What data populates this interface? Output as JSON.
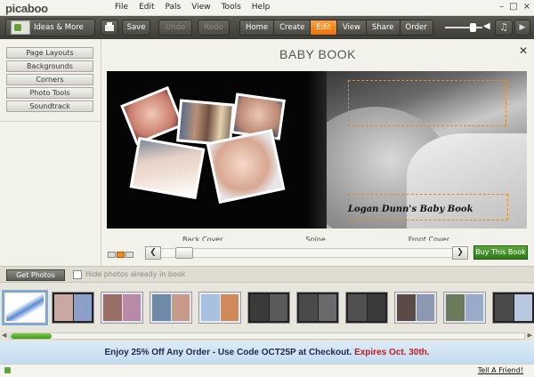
{
  "app": {
    "logo": "picaboo"
  },
  "menu": [
    "File",
    "Edit",
    "Pals",
    "View",
    "Tools",
    "Help"
  ],
  "toolbar": {
    "ideas_label": "Ideas & More",
    "save_label": "Save",
    "undo_label": "Undo",
    "redo_label": "Redo",
    "nav": [
      "Home",
      "Create",
      "Edit",
      "View",
      "Share",
      "Order"
    ],
    "active_nav": "Edit",
    "accent": "#f07800"
  },
  "sidebar": {
    "items": [
      {
        "label": "Page Layouts"
      },
      {
        "label": "Backgrounds"
      },
      {
        "label": "Corners"
      },
      {
        "label": "Photo Tools"
      },
      {
        "label": "Soundtrack"
      }
    ]
  },
  "main": {
    "title": "BABY BOOK",
    "caption": "Logan Dunn's Baby Book",
    "spread_labels": [
      "Back Cover",
      "Spine",
      "Front Cover"
    ],
    "buy_label": "Buy This Book"
  },
  "photos": {
    "get_label": "Get Photos",
    "hide_label": "Hide photos already in book",
    "hide_checked": false
  },
  "promo": {
    "text": "Enjoy 25% Off Any Order - Use Code OCT25P at Checkout. ",
    "expires": "Expires Oct. 30th."
  },
  "status": {
    "tell_friend": "Tell A Friend!"
  }
}
